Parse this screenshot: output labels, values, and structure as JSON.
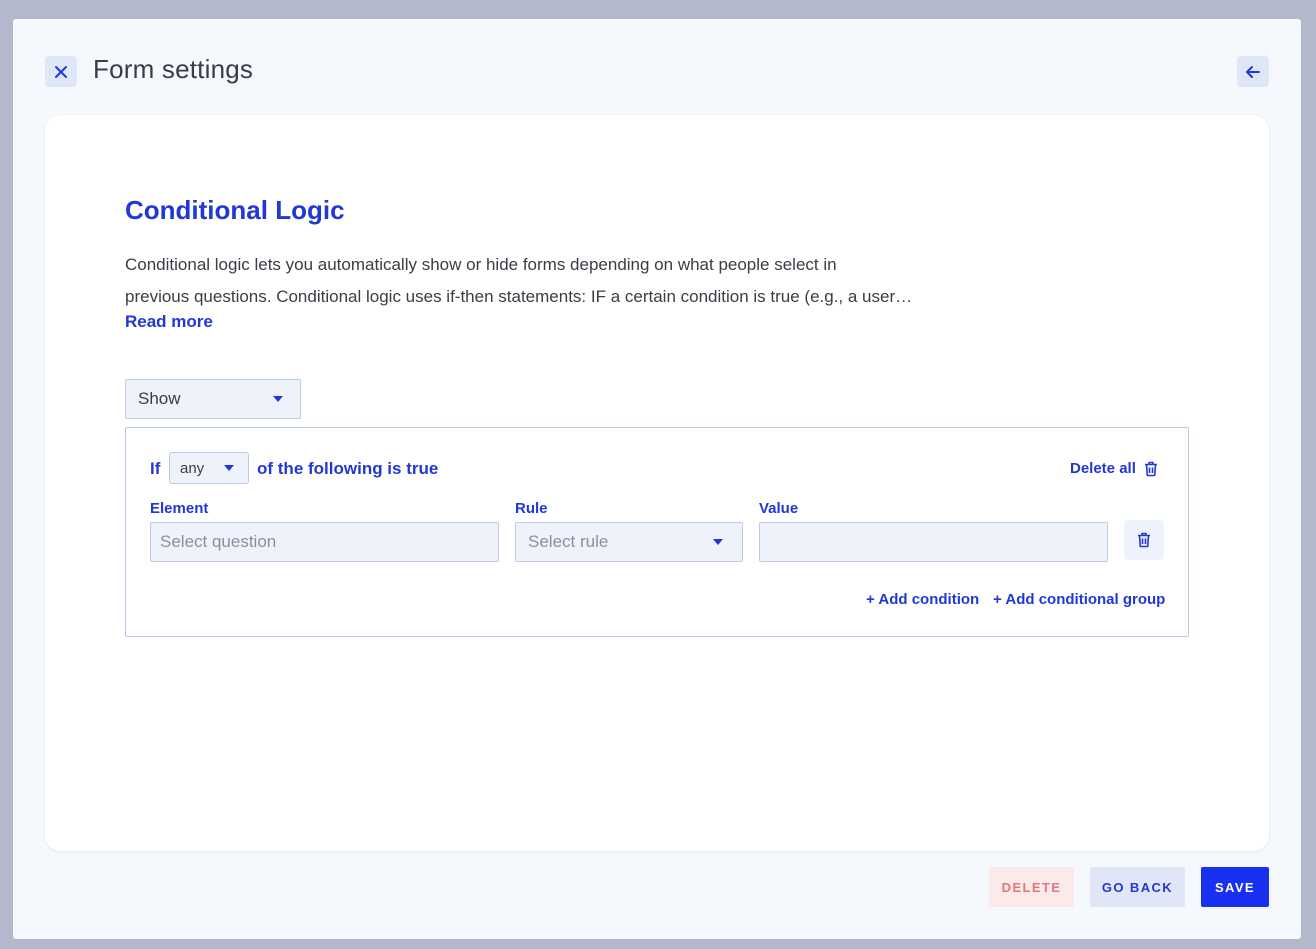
{
  "header": {
    "title": "Form settings",
    "close_icon": "close-icon",
    "back_icon": "arrow-left-icon"
  },
  "section": {
    "title": "Conditional Logic",
    "description_line1": "Conditional logic lets you automatically show or hide forms depending on what people select in",
    "description_line2": "previous questions. Conditional logic uses if-then statements: IF a certain condition is true (e.g., a user…",
    "read_more": "Read more"
  },
  "action_select": {
    "value": "Show"
  },
  "group": {
    "if_label": "If",
    "match_select": "any",
    "following_label": "of the following is true",
    "delete_all": "Delete all",
    "columns": {
      "element": "Element",
      "rule": "Rule",
      "value": "Value"
    },
    "condition": {
      "element_placeholder": "Select question",
      "rule_placeholder": "Select rule",
      "value": ""
    },
    "add_condition": "+ Add condition",
    "add_group": "+ Add conditional group"
  },
  "footer": {
    "delete": "DELETE",
    "go_back": "GO BACK",
    "save": "SAVE"
  },
  "colors": {
    "accent": "#2238d6",
    "primary_button": "#1a30f0",
    "danger_text": "#e0797f",
    "danger_bg": "#fce9ea"
  }
}
